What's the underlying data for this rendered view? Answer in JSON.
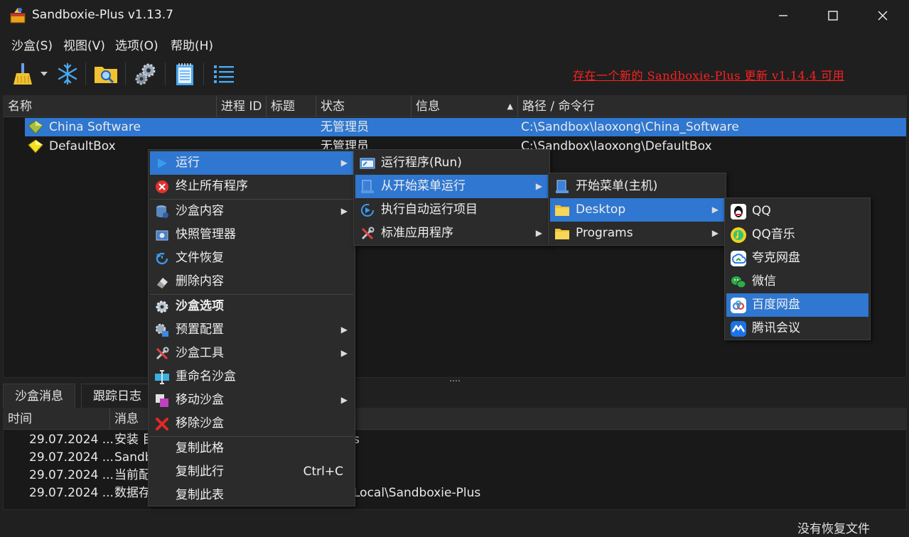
{
  "window": {
    "title": "Sandboxie-Plus v1.13.7"
  },
  "menubar": {
    "items": [
      "沙盒(S)",
      "视图(V)",
      "选项(O)",
      "帮助(H)"
    ]
  },
  "toolbar": {
    "buttons": [
      "broom-icon",
      "snowflake-icon",
      "folder-search-icon",
      "gears-icon",
      "notepad-icon",
      "list-icon"
    ],
    "update_notice": "存在一个新的 Sandboxie-Plus 更新 v1.14.4 可用",
    "update_color": "#ff2020"
  },
  "tree": {
    "columns": [
      "名称",
      "进程 ID",
      "标题",
      "状态",
      "信息",
      "路径 / 命令行"
    ],
    "rows": [
      {
        "name": "China Software",
        "status": "无管理员",
        "path": "C:\\Sandbox\\laoxong\\China_Software",
        "selected": true
      },
      {
        "name": "DefaultBox",
        "status": "无管理员",
        "path": "C:\\Sandbox\\laoxong\\DefaultBox",
        "selected": false
      }
    ]
  },
  "bottom": {
    "tabs": [
      "沙盒消息",
      "跟踪日志"
    ],
    "columns": [
      "时间",
      "消息"
    ],
    "rows": [
      {
        "time": "29.07.2024 ...",
        "msg": "安装 目",
        "tail": "s"
      },
      {
        "time": "29.07.2024 ...",
        "msg": "Sandb",
        "tail": ""
      },
      {
        "time": "29.07.2024 ...",
        "msg": "当前配",
        "tail": ""
      },
      {
        "time": "29.07.2024 ...",
        "msg": "数据存",
        "tail": "Local\\Sandboxie-Plus"
      }
    ]
  },
  "status": {
    "text": "没有恢复文件"
  },
  "context_menu": {
    "items": [
      {
        "label": "运行",
        "icon": "play-icon",
        "submenu": true,
        "selected": true
      },
      {
        "label": "终止所有程序",
        "icon": "stop-icon"
      },
      {
        "label": "沙盒内容",
        "icon": "db-icon",
        "submenu": true
      },
      {
        "label": "快照管理器",
        "icon": "snapshot-icon"
      },
      {
        "label": "文件恢复",
        "icon": "recover-icon"
      },
      {
        "label": "删除内容",
        "icon": "eraser-icon"
      },
      {
        "label": "沙盒选项",
        "icon": "gear-icon",
        "bold": true
      },
      {
        "label": "预置配置",
        "icon": "preset-icon",
        "submenu": true
      },
      {
        "label": "沙盒工具",
        "icon": "tools-icon",
        "submenu": true
      },
      {
        "label": "重命名沙盒",
        "icon": "rename-icon"
      },
      {
        "label": "移动沙盒",
        "icon": "move-icon",
        "submenu": true
      },
      {
        "label": "移除沙盒",
        "icon": "remove-icon"
      },
      {
        "label": "复制此格"
      },
      {
        "label": "复制此行",
        "shortcut": "Ctrl+C"
      },
      {
        "label": "复制此表"
      }
    ]
  },
  "run_menu": {
    "items": [
      {
        "label": "运行程序(Run)",
        "icon": "run-icon"
      },
      {
        "label": "从开始菜单运行",
        "icon": "startmenu-icon",
        "submenu": true,
        "selected": true
      },
      {
        "label": "执行自动运行项目",
        "icon": "autorun-icon"
      },
      {
        "label": "标准应用程序",
        "icon": "tools-icon",
        "submenu": true
      }
    ]
  },
  "start_menu": {
    "items": [
      {
        "label": "开始菜单(主机)",
        "icon": "startmenu-icon"
      },
      {
        "label": "Desktop",
        "icon": "folder-icon",
        "submenu": true,
        "selected": true
      },
      {
        "label": "Programs",
        "icon": "folder-icon",
        "submenu": true
      }
    ]
  },
  "desktop_menu": {
    "items": [
      {
        "label": "QQ",
        "icon": "qq-icon"
      },
      {
        "label": "QQ音乐",
        "icon": "qqmusic-icon"
      },
      {
        "label": "夸克网盘",
        "icon": "quark-icon"
      },
      {
        "label": "微信",
        "icon": "wechat-icon"
      },
      {
        "label": "百度网盘",
        "icon": "baidu-netdisk-icon",
        "selected": true
      },
      {
        "label": "腾讯会议",
        "icon": "tencent-meeting-icon"
      }
    ]
  },
  "colors": {
    "accent": "#2f77d0",
    "background": "#202020",
    "menu_bg": "#2b2b2b"
  }
}
